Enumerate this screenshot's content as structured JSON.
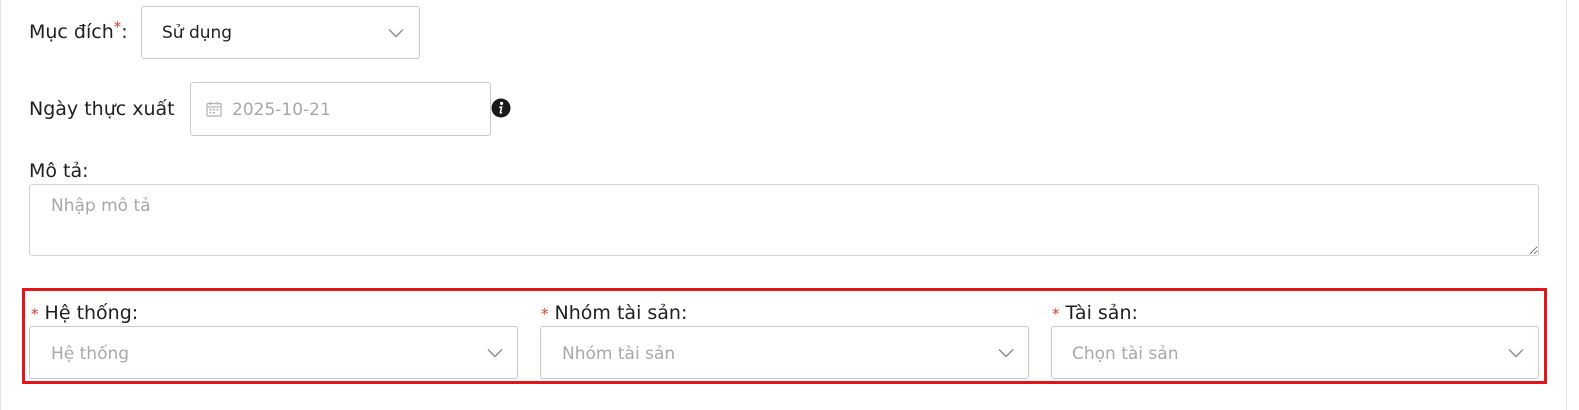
{
  "purpose": {
    "label": "Mục đích",
    "required_mark": "*",
    "colon": ":",
    "value": "Sử dụng"
  },
  "export_date": {
    "label": "Ngày thực xuất",
    "placeholder": "2025-10-21",
    "calendar_icon": "calendar-icon",
    "info_icon": "info-icon"
  },
  "description": {
    "label": "Mô tả:",
    "placeholder": "Nhập mô tả"
  },
  "selectors": [
    {
      "required_mark": "*",
      "label": "Hệ thống:",
      "placeholder": "Hệ thống"
    },
    {
      "required_mark": "*",
      "label": "Nhóm tài sản:",
      "placeholder": "Nhóm tài sản"
    },
    {
      "required_mark": "*",
      "label": "Tài sản:",
      "placeholder": "Chọn tài sản"
    }
  ],
  "colors": {
    "highlight_border": "#e3141c",
    "required": "#e53935",
    "placeholder": "#a8a8a8"
  }
}
